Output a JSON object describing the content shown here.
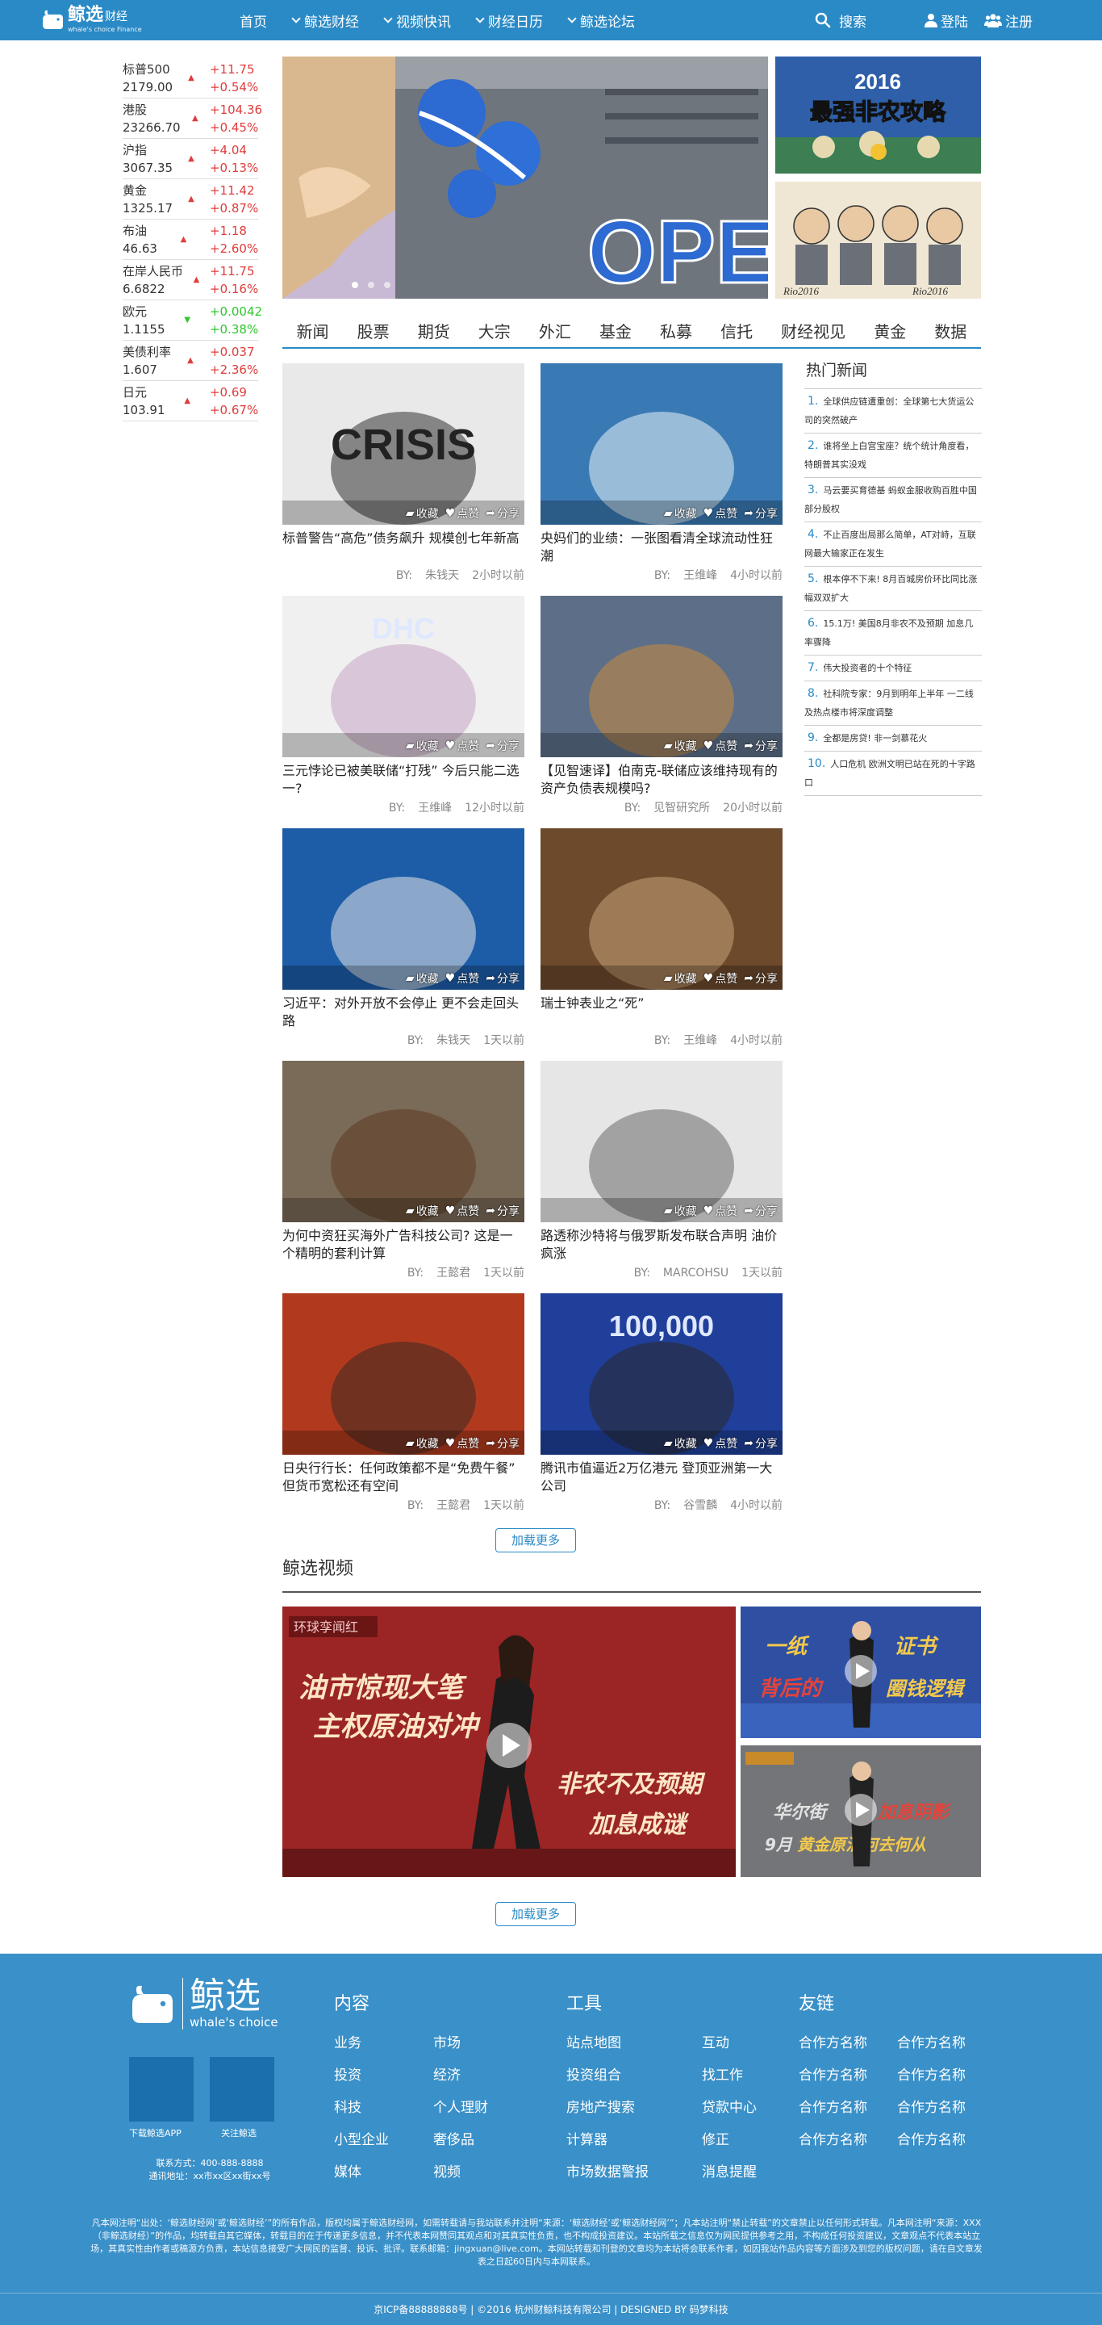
{
  "header": {
    "logo_main": "鲸选",
    "logo_suffix": "财经",
    "logo_sub": "whale's choice Finance",
    "nav": [
      {
        "label": "首页",
        "dropdown": false
      },
      {
        "label": "鲸选财经",
        "dropdown": true
      },
      {
        "label": "视频快讯",
        "dropdown": true
      },
      {
        "label": "财经日历",
        "dropdown": true
      },
      {
        "label": "鲸选论坛",
        "dropdown": true
      }
    ],
    "search_label": "搜索",
    "login_label": "登陆",
    "register_label": "注册"
  },
  "ticker": [
    {
      "name": "标普500",
      "price": "2179.00",
      "change": "+11.75",
      "pct": "+0.54%",
      "dir": "up"
    },
    {
      "name": "港股",
      "price": "23266.70",
      "change": "+104.36",
      "pct": "+0.45%",
      "dir": "up"
    },
    {
      "name": "沪指",
      "price": "3067.35",
      "change": "+4.04",
      "pct": "+0.13%",
      "dir": "up"
    },
    {
      "name": "黄金",
      "price": "1325.17",
      "change": "+11.42",
      "pct": "+0.87%",
      "dir": "up"
    },
    {
      "name": "布油",
      "price": "46.63",
      "change": "+1.18",
      "pct": "+2.60%",
      "dir": "up"
    },
    {
      "name": "在岸人民币",
      "price": "6.6822",
      "change": "+11.75",
      "pct": "+0.16%",
      "dir": "up"
    },
    {
      "name": "欧元",
      "price": "1.1155",
      "change": "+0.0042",
      "pct": "+0.38%",
      "dir": "down"
    },
    {
      "name": "美债利率",
      "price": "1.607",
      "change": "+0.037",
      "pct": "+2.36%",
      "dir": "up"
    },
    {
      "name": "日元",
      "price": "103.91",
      "change": "+0.69",
      "pct": "+0.67%",
      "dir": "up"
    }
  ],
  "slider": {
    "banner_text": "OPE",
    "side_banner_1": "2016 最强非农攻略",
    "side_banner_2_a": "Rio2016",
    "side_banner_2_b": "Rio2016"
  },
  "categories": [
    "新闻",
    "股票",
    "期货",
    "大宗",
    "外汇",
    "基金",
    "私募",
    "信托",
    "财经视见",
    "黄金",
    "数据"
  ],
  "actions": {
    "collect": "收藏",
    "like": "点赞",
    "share": "分享"
  },
  "news": [
    {
      "title": "标普警告“高危”债务飙升 规模创七年新高",
      "author": "朱钱天",
      "time": "2小时以前",
      "img_text": "CRISIS"
    },
    {
      "title": "央妈们的业绩：一张图看清全球流动性狂潮",
      "author": "王维峰",
      "time": "4小时以前",
      "img_text": ""
    },
    {
      "title": "三元悖论已被美联储“打残” 今后只能二选一?",
      "author": "王维峰",
      "time": "12小时以前",
      "img_text": "DHC"
    },
    {
      "title": "【见智速译】伯南克-联储应该维持现有的资产负债表规模吗?",
      "author": "见智研究所",
      "time": "20小时以前",
      "img_text": ""
    },
    {
      "title": "习近平：对外开放不会停止 更不会走回头路",
      "author": "朱钱天",
      "time": "1天以前",
      "img_text": ""
    },
    {
      "title": "瑞士钟表业之“死”",
      "author": "王维峰",
      "time": "4小时以前",
      "img_text": ""
    },
    {
      "title": "为何中资狂买海外广告科技公司? 这是一个精明的套利计算",
      "author": "王懿君",
      "time": "1天以前",
      "img_text": ""
    },
    {
      "title": "路透称沙特将与俄罗斯发布联合声明 油价疯涨",
      "author": "MARCOHSU",
      "time": "1天以前",
      "img_text": ""
    },
    {
      "title": "日央行行长：任何政策都不是“免费午餐” 但货币宽松还有空间",
      "author": "王懿君",
      "time": "1天以前",
      "img_text": ""
    },
    {
      "title": "腾讯市值逼近2万亿港元 登顶亚洲第一大公司",
      "author": "谷雪麟",
      "time": "4小时以前",
      "img_text": "100,000"
    }
  ],
  "by_label": "BY:",
  "hot_news": {
    "title": "热门新闻",
    "items": [
      "全球供应链遭重创：全球第七大货运公司的突然破产",
      "谁将坐上白宫宝座？统个统计角度看，特朗普其实没戏",
      "马云要买育德基 蚂蚁金服收购百胜中国部分股权",
      "不止百度出局那么简单，AT对峙，互联网最大输家正在发生",
      "根本停不下来! 8月百城房价环比同比涨幅双双扩大",
      "15.1万! 美国8月非农不及预期 加息几率骤降",
      "伟大投资者的十个特征",
      "社科院专家：9月到明年上半年 一二线及热点楼市将深度调整",
      "全都是房贷! 非一剑慕花火",
      "人口危机 欧洲文明已站在死的十字路口"
    ]
  },
  "load_more": "加载更多",
  "video": {
    "heading": "鲸选视频",
    "main_tag": "环球孪闻红",
    "main_line1": "油市惊现大笔",
    "main_line2": "主权原油对冲",
    "main_line3": "非农不及预期",
    "main_line4": "加息成谜",
    "side1_line1": "一纸",
    "side1_line2": "证书",
    "side1_line3": "背后的",
    "side1_line4": "圈钱逻辑",
    "side2_line1": "华尔街",
    "side2_line2": "加息阴影",
    "side2_line3": "9月",
    "side2_line4": "黄金原油何去何从"
  },
  "footer": {
    "logo_main": "鲸选",
    "logo_sub": "whale's choice",
    "qr1_label": "下载鲸选APP",
    "qr2_label": "关注鲸选",
    "contact_phone": "联系方式：400-888-8888",
    "contact_addr": "通讯地址：xx市xx区xx街xx号",
    "col1": {
      "heading": "内容",
      "links": [
        "业务",
        "市场",
        "投资",
        "经济",
        "科技",
        "个人理财",
        "小型企业",
        "奢侈品",
        "媒体",
        "视频"
      ]
    },
    "col2": {
      "heading": "工具",
      "links": [
        "站点地图",
        "互动",
        "投资组合",
        "找工作",
        "房地产搜索",
        "贷款中心",
        "计算器",
        "修正",
        "市场数据警报",
        "消息提醒"
      ]
    },
    "col3": {
      "heading": "友链",
      "links": [
        "合作方名称",
        "合作方名称",
        "合作方名称",
        "合作方名称",
        "合作方名称",
        "合作方名称",
        "合作方名称",
        "合作方名称"
      ]
    },
    "notice": "凡本网注明“出处：‘鲸选财经网’或‘鲸选财经’”的所有作品，版权均属于鲸选财经网，如需转载请与我站联系并注明“来源：‘鲸选财经’或‘鲸选财经网’”；凡本站注明“禁止转载”的文章禁止以任何形式转载。凡本网注明“来源：XXX（非鲸选财经）”的作品，均转载自其它媒体，转载目的在于传递更多信息，并不代表本网赞同其观点和对其真实性负责，也不构成投资建议。本站所载之信息仅为网民提供参考之用，不构成任何投资建议，文章观点不代表本站立场，其真实性由作者或稿源方负责，本站信息接受广大网民的监督、投诉、批评。联系邮箱：jingxuan@live.com。本网站转载和刊登的文章均为本站将会联系作者，如因我站作品内容等方面涉及到您的版权问题，请在自文章发表之日起60日内与本网联系。",
    "bottom": "京ICP备88888888号 | ©2016 杭州财鲸科技有限公司 | DESIGNED BY 码梦科技"
  },
  "colors": {
    "brand": "#2a8ac6",
    "up": "#e03c3c",
    "down": "#2ec82e",
    "footer": "#3a90c8"
  }
}
